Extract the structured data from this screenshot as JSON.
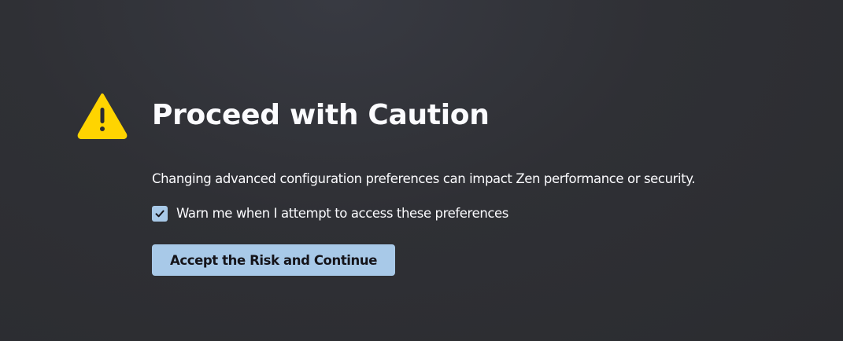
{
  "warning": {
    "icon": "warning-triangle-icon",
    "color": "#ffd400"
  },
  "title": "Proceed with Caution",
  "description": "Changing advanced configuration preferences can impact Zen performance or security.",
  "checkbox": {
    "label": "Warn me when I attempt to access these preferences",
    "checked": true,
    "accent_color": "#a8c9e8"
  },
  "button": {
    "label": "Accept the Risk and Continue",
    "background": "#a8c9e8"
  },
  "colors": {
    "background": "#2f3035",
    "text": "#fbfbfe"
  }
}
